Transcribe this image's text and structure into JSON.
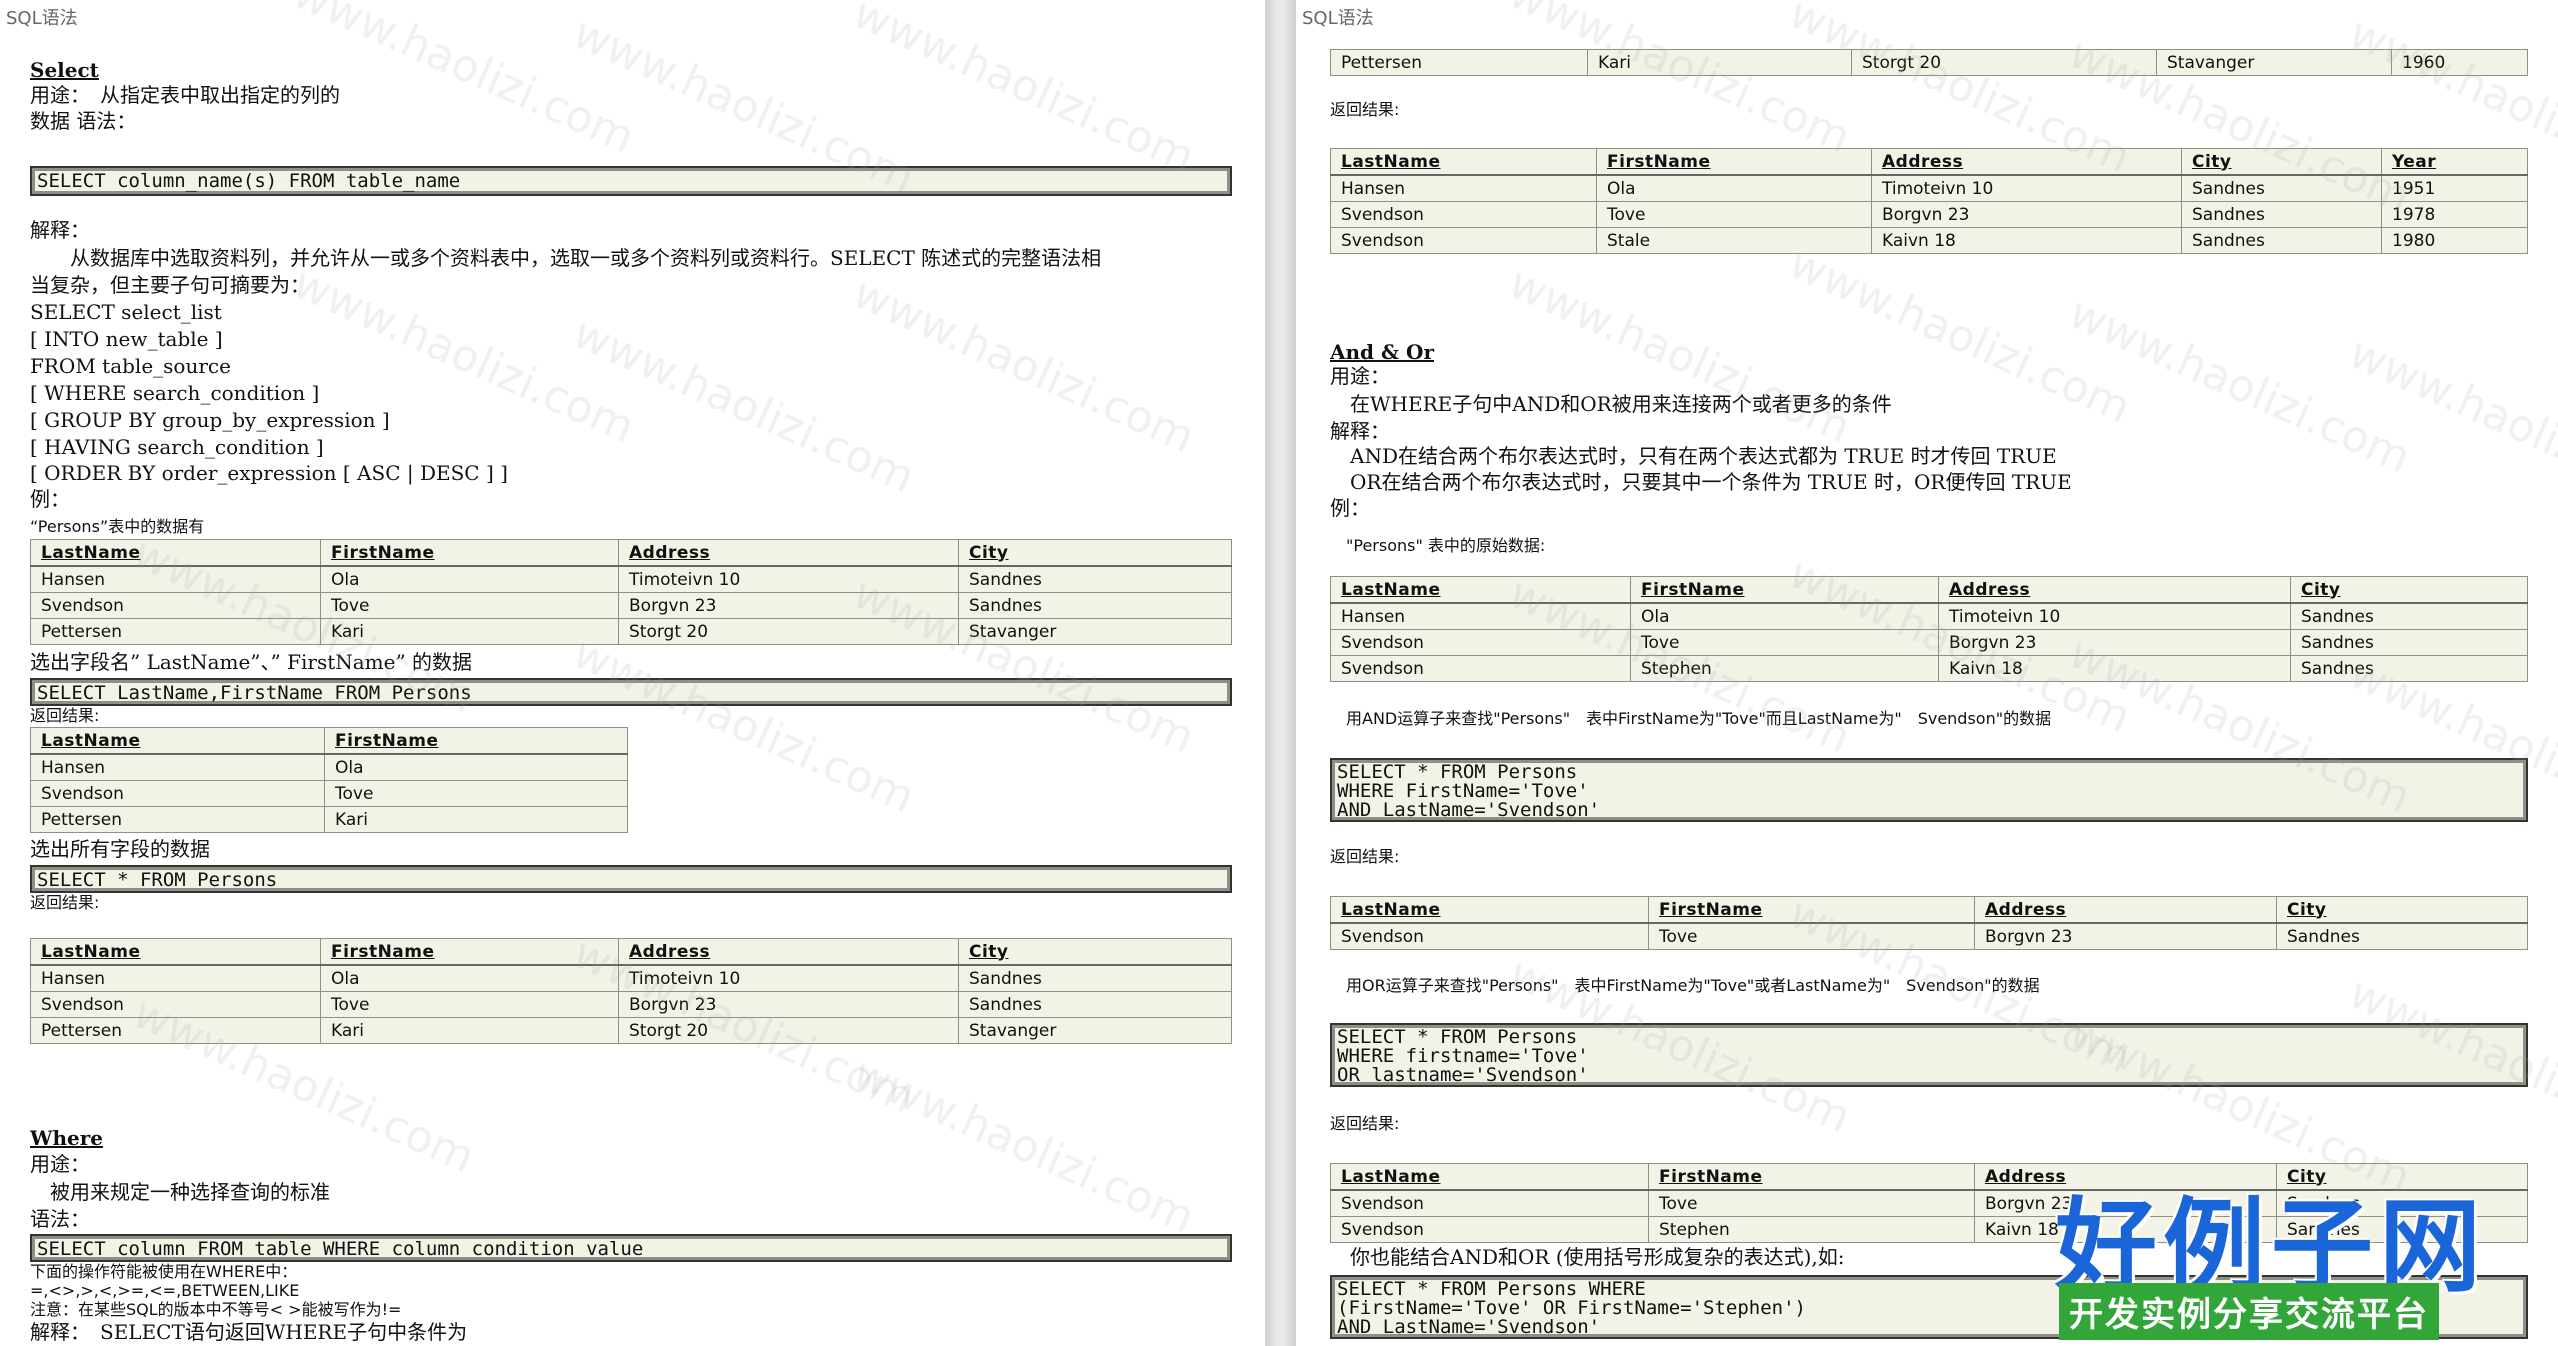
{
  "page_header": "SQL语法",
  "watermark": "www.haolizi.com",
  "left": {
    "select_heading": "Select",
    "usage_line": "用途：　从指定表中取出指定的列的",
    "data_syntax_line": "数据  语法：",
    "code_select": "SELECT column_name(s) FROM table_name",
    "explain_label": "解释：",
    "explain_line1": "　　从数据库中选取资料列，并允许从一或多个资料表中，选取一或多个资料列或资料行。SELECT 陈述式的完整语法相",
    "explain_line2": "当复杂，但主要子句可摘要为：",
    "syntax_lines": [
      "SELECT select_list",
      " [ INTO new_table ]",
      " FROM table_source",
      " [ WHERE search_condition ]",
      " [ GROUP BY group_by_expression ]",
      " [ HAVING search_condition ]",
      " [ ORDER BY order_expression [ ASC | DESC ] ]"
    ],
    "example_label": "例：",
    "persons_caption": "“Persons”表中的数据有",
    "table1": {
      "headers": [
        "LastName",
        "FirstName",
        "Address",
        "City"
      ],
      "rows": [
        [
          "Hansen",
          "Ola",
          "Timoteivn 10",
          "Sandnes"
        ],
        [
          "Svendson",
          "Tove",
          "Borgvn 23",
          "Sandnes"
        ],
        [
          "Pettersen",
          "Kari",
          "Storgt 20",
          "Stavanger"
        ]
      ]
    },
    "select_fields_caption": "选出字段名” LastName”、” FirstName” 的数据",
    "code_select_fields": "SELECT LastName,FirstName FROM Persons",
    "return_label1": "返回结果:",
    "table2": {
      "headers": [
        "LastName",
        "FirstName"
      ],
      "rows": [
        [
          "Hansen",
          "Ola"
        ],
        [
          "Svendson",
          "Tove"
        ],
        [
          "Pettersen",
          "Kari"
        ]
      ]
    },
    "select_all_caption": "选出所有字段的数据",
    "code_select_all": "SELECT * FROM Persons",
    "return_label2": "返回结果:",
    "table3": {
      "headers": [
        "LastName",
        "FirstName",
        "Address",
        "City"
      ],
      "rows": [
        [
          "Hansen",
          "Ola",
          "Timoteivn 10",
          "Sandnes"
        ],
        [
          "Svendson",
          "Tove",
          "Borgvn 23",
          "Sandnes"
        ],
        [
          "Pettersen",
          "Kari",
          "Storgt 20",
          "Stavanger"
        ]
      ]
    },
    "where_heading": "Where",
    "where_usage_label": "用途：",
    "where_usage_text": "　被用来规定一种选择查询的标准",
    "where_syntax_label": "语法：",
    "code_where": "SELECT column FROM table WHERE column condition value",
    "operators_line1": "下面的操作符能被使用在WHERE中：",
    "operators_line2": "=,<>,>,<,>=,<=,BETWEEN,LIKE",
    "operators_note": "注意：在某些SQL的版本中不等号< >能被写作为!=",
    "where_explain": "解释：　SELECT语句返回WHERE子句中条件为"
  },
  "right": {
    "top_row": [
      "Pettersen",
      "Kari",
      "Storgt 20",
      "Stavanger",
      "1960"
    ],
    "return_label_a": "返回结果:",
    "table_year": {
      "headers": [
        "LastName",
        "FirstName",
        "Address",
        "City",
        "Year"
      ],
      "rows": [
        [
          "Hansen",
          "Ola",
          "Timoteivn 10",
          "Sandnes",
          "1951"
        ],
        [
          "Svendson",
          "Tove",
          "Borgvn 23",
          "Sandnes",
          "1978"
        ],
        [
          "Svendson",
          "Stale",
          "Kaivn 18",
          "Sandnes",
          "1980"
        ]
      ]
    },
    "andor_heading": "And & Or",
    "andor_usage_label": "用途：",
    "andor_usage_text": "　在WHERE子句中AND和OR被用来连接两个或者更多的条件",
    "andor_explain_label": "解释：",
    "andor_explain1": "　AND在结合两个布尔表达式时，只有在两个表达式都为 TRUE 时才传回 TRUE",
    "andor_explain2": "　OR在结合两个布尔表达式时，只要其中一个条件为 TRUE 时，OR便传回 TRUE",
    "andor_example_label": "例：",
    "persons_orig_caption": "　\"Persons\" 表中的原始数据:",
    "table_orig": {
      "headers": [
        "LastName",
        "FirstName",
        "Address",
        "City"
      ],
      "rows": [
        [
          "Hansen",
          "Ola",
          "Timoteivn 10",
          "Sandnes"
        ],
        [
          "Svendson",
          "Tove",
          "Borgvn 23",
          "Sandnes"
        ],
        [
          "Svendson",
          "Stephen",
          "Kaivn 18",
          "Sandnes"
        ]
      ]
    },
    "and_caption": "　用AND运算子来查找\"Persons\"　表中FirstName为\"Tove\"而且LastName为\"　Svendson\"的数据",
    "code_and": "SELECT * FROM Persons\nWHERE FirstName='Tove'\nAND LastName='Svendson'",
    "return_label_b": "返回结果:",
    "table_and": {
      "headers": [
        "LastName",
        "FirstName",
        "Address",
        "City"
      ],
      "rows": [
        [
          "Svendson",
          "Tove",
          "Borgvn 23",
          "Sandnes"
        ]
      ]
    },
    "or_caption": "　用OR运算子来查找\"Persons\"　表中FirstName为\"Tove\"或者LastName为\"　Svendson\"的数据",
    "code_or": "SELECT * FROM Persons\nWHERE firstname='Tove'\nOR lastname='Svendson'",
    "return_label_c": "返回结果:",
    "table_or": {
      "headers": [
        "LastName",
        "FirstName",
        "Address",
        "City"
      ],
      "rows": [
        [
          "Svendson",
          "Tove",
          "Borgvn 23",
          "Sandnes"
        ],
        [
          "Svendson",
          "Stephen",
          "Kaivn 18",
          "Sandnes"
        ]
      ]
    },
    "combine_caption": "　你也能结合AND和OR (使用括号形成复杂的表达式),如:",
    "code_combine": "SELECT * FROM Persons WHERE\n(FirstName='Tove' OR FirstName='Stephen')\nAND LastName='Svendson'"
  },
  "brand": {
    "title": "好例子网",
    "subtitle": "开发实例分享交流平台",
    "title_color": "#1a66d8",
    "subtitle_bg": "#33a63a"
  }
}
